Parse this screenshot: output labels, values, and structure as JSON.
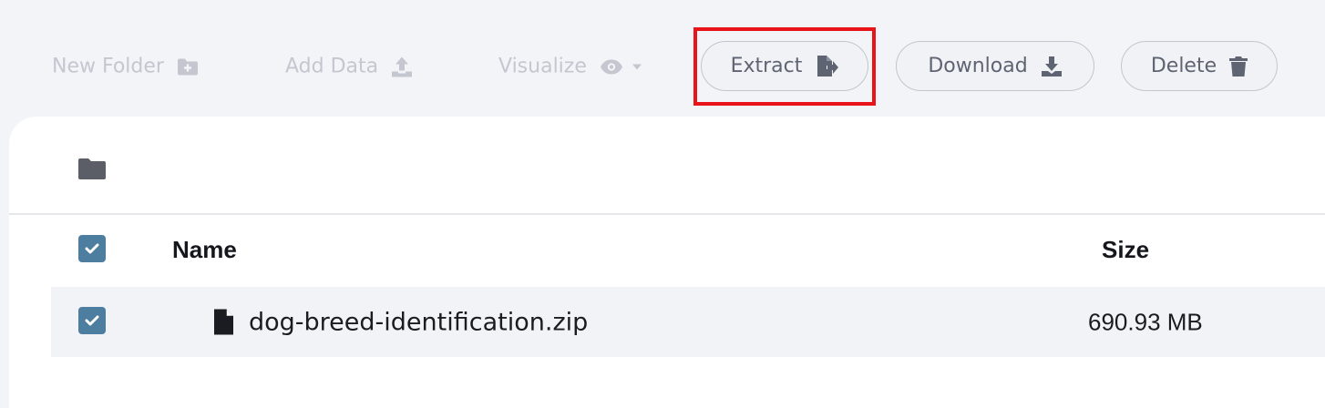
{
  "toolbar": {
    "new_folder_label": "New Folder",
    "add_data_label": "Add Data",
    "visualize_label": "Visualize",
    "extract_label": "Extract",
    "download_label": "Download",
    "delete_label": "Delete"
  },
  "table": {
    "columns": [
      "Name",
      "Size"
    ],
    "rows": [
      {
        "name": "dog-breed-identification.zip",
        "size": "690.93 MB",
        "checked": true
      }
    ]
  },
  "colors": {
    "accent": "#4d7ea0",
    "highlight": "#e8141a",
    "disabled_text": "#c4c7d0",
    "button_text": "#5f6473"
  },
  "icons": {
    "new_folder": "folder-plus-icon",
    "add_data": "upload-icon",
    "visualize": "eye-icon",
    "extract": "file-export-icon",
    "download": "download-icon",
    "delete": "trash-icon",
    "breadcrumb": "folder-icon",
    "file": "file-icon",
    "checkbox": "check-icon"
  }
}
